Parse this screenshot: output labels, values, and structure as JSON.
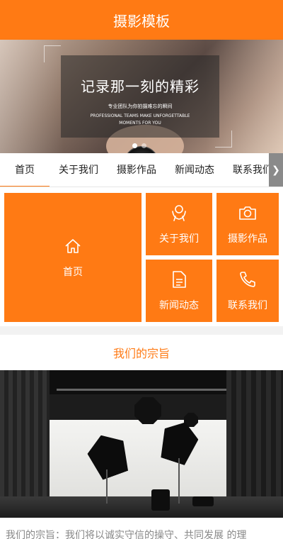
{
  "header": {
    "title": "摄影模板"
  },
  "banner": {
    "headline": "记录那一刻的精彩",
    "subline": "专业团队为你拍摄难忘的瞬间",
    "english": "PROFESSIONAL TEAMS MAKE UNFORGETTABLE MOMENTS FOR YOU",
    "slide_count": 2,
    "active_slide": 1
  },
  "nav": {
    "tabs": [
      {
        "label": "首页",
        "active": true
      },
      {
        "label": "关于我们"
      },
      {
        "label": "摄影作品"
      },
      {
        "label": "新闻动态"
      },
      {
        "label": "联系我们"
      }
    ],
    "next_icon": "chevron-right-icon"
  },
  "grid": {
    "home": {
      "label": "首页",
      "icon": "home-icon"
    },
    "about": {
      "label": "关于我们",
      "icon": "people-icon"
    },
    "works": {
      "label": "摄影作品",
      "icon": "camera-icon"
    },
    "news": {
      "label": "新闻动态",
      "icon": "document-icon"
    },
    "contact": {
      "label": "联系我们",
      "icon": "phone-icon"
    }
  },
  "section": {
    "title": "我们的宗旨"
  },
  "description": {
    "text": "我们的宗旨：我们将以诚实守信的操守、共同发展 的理"
  },
  "colors": {
    "accent": "#ff7a14",
    "nav_arrow": "#8a8a8a"
  }
}
